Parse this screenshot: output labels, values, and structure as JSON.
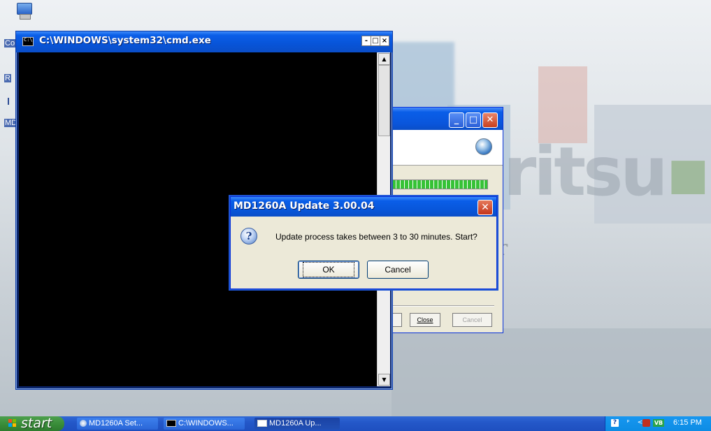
{
  "desktop": {
    "icon_labels": [
      "Co",
      "R",
      "MD"
    ],
    "brand_fragment_a": "ritsu",
    "brand_fragment_b": "r"
  },
  "cmd_window": {
    "title": "C:\\WINDOWS\\system32\\cmd.exe",
    "min_glyph": "-",
    "max_glyph": "□",
    "close_glyph": "×",
    "scroll_up_glyph": "▲",
    "scroll_down_glyph": "▼"
  },
  "setup_window": {
    "min_glyph": "_",
    "max_glyph": "□",
    "close_glyph": "✕",
    "close_label": "Close",
    "cancel_label": "Cancel",
    "progress": 1.0
  },
  "dialog": {
    "title": "MD1260A Update 3.00.04",
    "close_glyph": "✕",
    "icon_glyph": "?",
    "message": "Update process takes between 3 to 30 minutes. Start?",
    "ok_label": "OK",
    "cancel_label": "Cancel"
  },
  "taskbar": {
    "start_label": "start",
    "tasks": [
      {
        "label": "MD1260A Set..."
      },
      {
        "label": "C:\\WINDOWS..."
      },
      {
        "label": "MD1260A Up..."
      }
    ],
    "clock": "6:15 PM",
    "tray_help_glyph": "?",
    "tray_net_glyph": "ᵖ",
    "tray_arrow_glyph": "<",
    "tray_vb_text": "VB"
  },
  "colors": {
    "title_bar": "#0a5ee8",
    "dialog_face": "#ece9d8",
    "start_green": "#378a37",
    "close_red": "#c5351a"
  }
}
